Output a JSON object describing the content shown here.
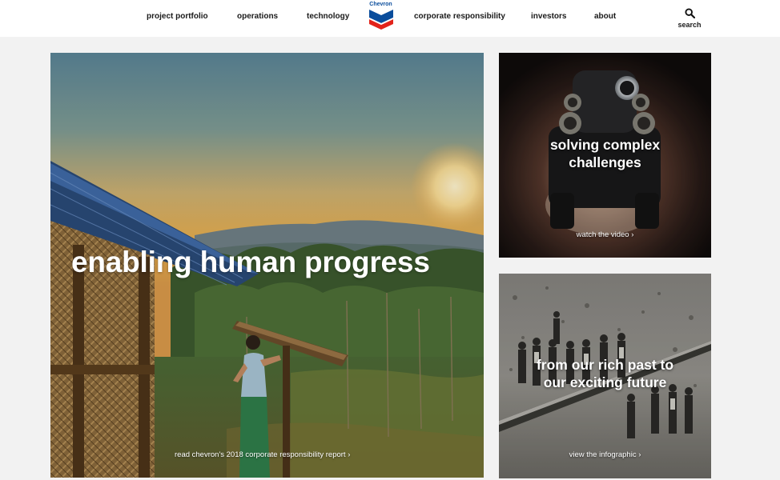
{
  "nav": {
    "items": [
      {
        "label": "project portfolio"
      },
      {
        "label": "operations"
      },
      {
        "label": "technology"
      },
      {
        "label": "corporate responsibility"
      },
      {
        "label": "investors"
      },
      {
        "label": "about"
      }
    ],
    "logo": {
      "word": "Chevron",
      "icon": "chevron-logo"
    },
    "search": {
      "label": "search",
      "icon": "search-icon"
    }
  },
  "hero": {
    "title": "enabling human progress",
    "link": "read chevron's 2018 corporate responsibility report ›"
  },
  "cards": [
    {
      "title_line1": "solving complex",
      "title_line2": "challenges",
      "link": "watch the video ›"
    },
    {
      "title_line1": "from our rich past to",
      "title_line2": "our exciting future",
      "link": "view the infographic ›"
    }
  ],
  "colors": {
    "brand_blue": "#0a4d9c",
    "brand_red": "#e2231a",
    "header_bg": "#ffffff",
    "page_bg": "#f2f2f2"
  }
}
